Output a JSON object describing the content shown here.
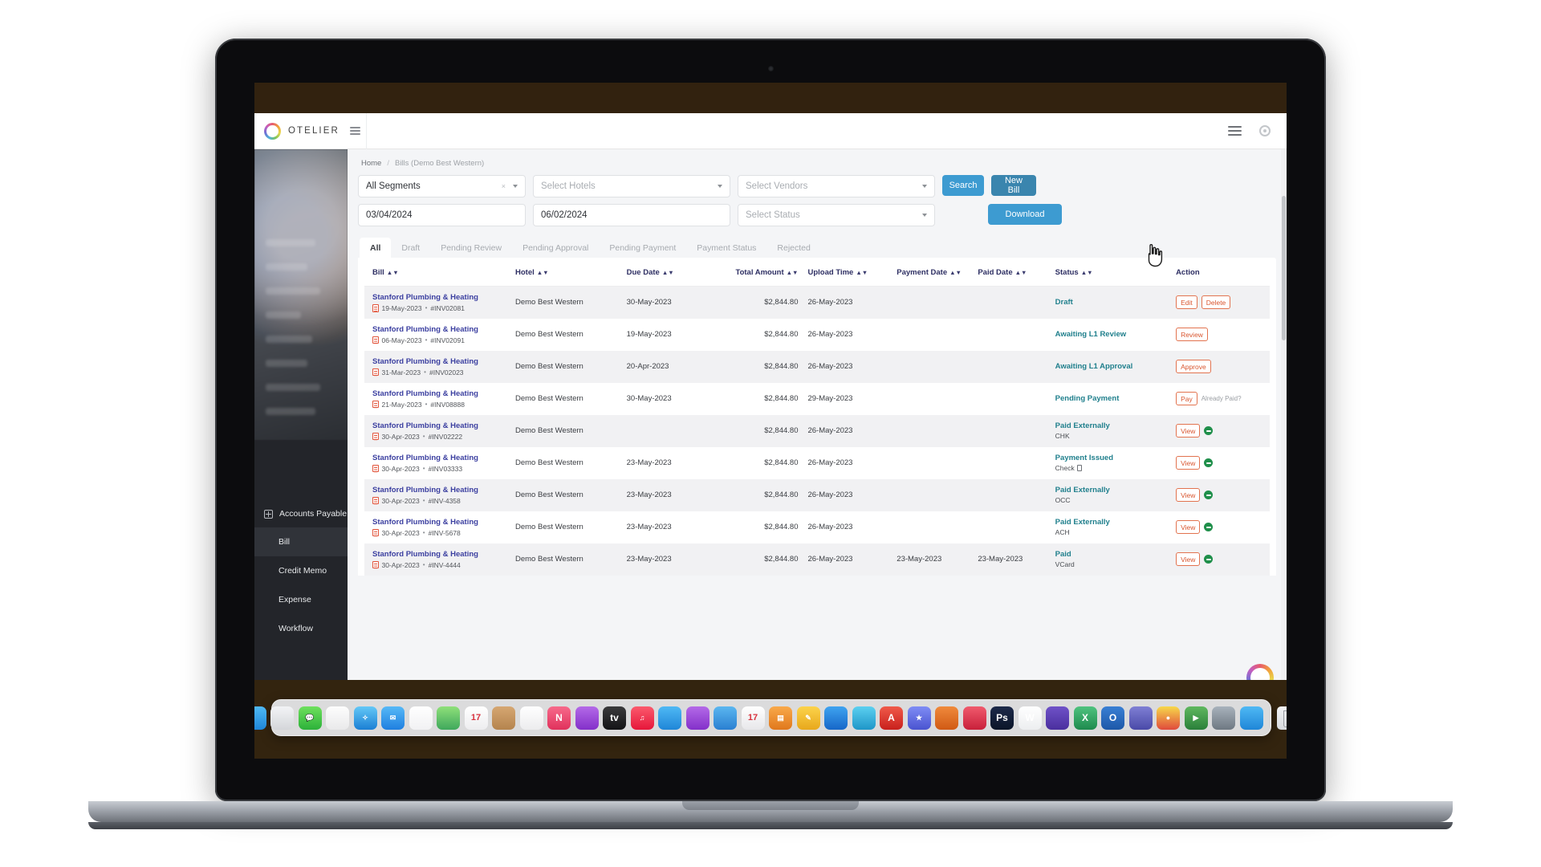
{
  "brand": {
    "name": "OTELIER",
    "menu_icon": "hamburger-icon",
    "ring_icon": "otelier-logo-ring"
  },
  "topbar": {
    "menu_icon": "hamburger-icon",
    "settings_icon": "gear-icon"
  },
  "sidebar": {
    "group_label": "Accounts Payable",
    "group_icon": "grid-icon",
    "items": [
      {
        "label": "Bill",
        "active": true
      },
      {
        "label": "Credit Memo",
        "active": false
      },
      {
        "label": "Expense",
        "active": false
      },
      {
        "label": "Workflow",
        "active": false
      }
    ]
  },
  "breadcrumb": {
    "home": "Home",
    "separator": "/",
    "current": "Bills (Demo Best Western)"
  },
  "filters": {
    "segment": {
      "value": "All Segments",
      "clear_icon": "clear-x-icon",
      "caret_icon": "chevron-down-icon"
    },
    "hotels": {
      "placeholder": "Select Hotels",
      "caret_icon": "chevron-down-icon"
    },
    "vendors": {
      "placeholder": "Select Vendors",
      "caret_icon": "chevron-down-icon"
    },
    "date_from": {
      "value": "03/04/2024"
    },
    "date_to": {
      "value": "06/02/2024"
    },
    "status": {
      "placeholder": "Select Status",
      "caret_icon": "chevron-down-icon"
    }
  },
  "buttons": {
    "search": "Search",
    "new_bill": "New Bill",
    "download": "Download"
  },
  "cursor": {
    "icon": "pointing-hand-cursor"
  },
  "tabs": [
    {
      "label": "All",
      "active": true
    },
    {
      "label": "Draft",
      "active": false
    },
    {
      "label": "Pending Review",
      "active": false
    },
    {
      "label": "Pending Approval",
      "active": false
    },
    {
      "label": "Pending Payment",
      "active": false
    },
    {
      "label": "Payment Status",
      "active": false
    },
    {
      "label": "Rejected",
      "active": false
    }
  ],
  "table": {
    "columns": [
      {
        "key": "bill",
        "label": "Bill",
        "sortable": true
      },
      {
        "key": "hotel",
        "label": "Hotel",
        "sortable": true
      },
      {
        "key": "due_date",
        "label": "Due Date",
        "sortable": true
      },
      {
        "key": "total_amount",
        "label": "Total Amount",
        "sortable": true
      },
      {
        "key": "upload_time",
        "label": "Upload Time",
        "sortable": true
      },
      {
        "key": "payment_date",
        "label": "Payment Date",
        "sortable": true
      },
      {
        "key": "paid_date",
        "label": "Paid Date",
        "sortable": true
      },
      {
        "key": "status",
        "label": "Status",
        "sortable": true
      },
      {
        "key": "action",
        "label": "Action",
        "sortable": false
      }
    ],
    "sort_icon": "sort-arrows-icon",
    "rows": [
      {
        "vendor": "Stanford Plumbing & Heating",
        "bill_date": "19-May-2023",
        "invoice_no": "#INV02081",
        "hotel": "Demo Best Western",
        "due_date": "30-May-2023",
        "total_amount": "$2,844.80",
        "upload_time": "26-May-2023",
        "payment_date": "",
        "paid_date": "",
        "status": "Draft",
        "status_sub": "",
        "actions": [
          "Edit",
          "Delete"
        ],
        "has_green_dot": false,
        "already_paid_text": ""
      },
      {
        "vendor": "Stanford Plumbing & Heating",
        "bill_date": "06-May-2023",
        "invoice_no": "#INV02091",
        "hotel": "Demo Best Western",
        "due_date": "19-May-2023",
        "total_amount": "$2,844.80",
        "upload_time": "26-May-2023",
        "payment_date": "",
        "paid_date": "",
        "status": "Awaiting L1 Review",
        "status_sub": "",
        "actions": [
          "Review"
        ],
        "has_green_dot": false,
        "already_paid_text": ""
      },
      {
        "vendor": "Stanford Plumbing & Heating",
        "bill_date": "31-Mar-2023",
        "invoice_no": "#INV02023",
        "hotel": "Demo Best Western",
        "due_date": "20-Apr-2023",
        "total_amount": "$2,844.80",
        "upload_time": "26-May-2023",
        "payment_date": "",
        "paid_date": "",
        "status": "Awaiting L1 Approval",
        "status_sub": "",
        "actions": [
          "Approve"
        ],
        "has_green_dot": false,
        "already_paid_text": ""
      },
      {
        "vendor": "Stanford Plumbing & Heating",
        "bill_date": "21-May-2023",
        "invoice_no": "#INV08888",
        "hotel": "Demo Best Western",
        "due_date": "30-May-2023",
        "total_amount": "$2,844.80",
        "upload_time": "29-May-2023",
        "payment_date": "",
        "paid_date": "",
        "status": "Pending Payment",
        "status_sub": "",
        "actions": [
          "Pay"
        ],
        "has_green_dot": false,
        "already_paid_text": "Already Paid?"
      },
      {
        "vendor": "Stanford Plumbing & Heating",
        "bill_date": "30-Apr-2023",
        "invoice_no": "#INV02222",
        "hotel": "Demo Best Western",
        "due_date": "",
        "total_amount": "$2,844.80",
        "upload_time": "26-May-2023",
        "payment_date": "",
        "paid_date": "",
        "status": "Paid Externally",
        "status_sub": "CHK",
        "actions": [
          "View"
        ],
        "has_green_dot": true,
        "already_paid_text": ""
      },
      {
        "vendor": "Stanford Plumbing & Heating",
        "bill_date": "30-Apr-2023",
        "invoice_no": "#INV03333",
        "hotel": "Demo Best Western",
        "due_date": "23-May-2023",
        "total_amount": "$2,844.80",
        "upload_time": "26-May-2023",
        "payment_date": "",
        "paid_date": "",
        "status": "Payment Issued",
        "status_sub": "Check",
        "status_sub_icon": "document-icon",
        "actions": [
          "View"
        ],
        "has_green_dot": true,
        "already_paid_text": ""
      },
      {
        "vendor": "Stanford Plumbing & Heating",
        "bill_date": "30-Apr-2023",
        "invoice_no": "#INV-4358",
        "hotel": "Demo Best Western",
        "due_date": "23-May-2023",
        "total_amount": "$2,844.80",
        "upload_time": "26-May-2023",
        "payment_date": "",
        "paid_date": "",
        "status": "Paid Externally",
        "status_sub": "OCC",
        "actions": [
          "View"
        ],
        "has_green_dot": true,
        "already_paid_text": ""
      },
      {
        "vendor": "Stanford Plumbing & Heating",
        "bill_date": "30-Apr-2023",
        "invoice_no": "#INV-5678",
        "hotel": "Demo Best Western",
        "due_date": "23-May-2023",
        "total_amount": "$2,844.80",
        "upload_time": "26-May-2023",
        "payment_date": "",
        "paid_date": "",
        "status": "Paid Externally",
        "status_sub": "ACH",
        "actions": [
          "View"
        ],
        "has_green_dot": true,
        "already_paid_text": ""
      },
      {
        "vendor": "Stanford Plumbing & Heating",
        "bill_date": "30-Apr-2023",
        "invoice_no": "#INV-4444",
        "hotel": "Demo Best Western",
        "due_date": "23-May-2023",
        "total_amount": "$2,844.80",
        "upload_time": "26-May-2023",
        "payment_date": "23-May-2023",
        "paid_date": "23-May-2023",
        "status": "Paid",
        "status_sub": "VCard",
        "actions": [
          "View"
        ],
        "has_green_dot": true,
        "already_paid_text": ""
      }
    ]
  },
  "colors": {
    "primary_blue": "#3d9bd1",
    "new_bill_blue": "#3a85ae",
    "vendor_purple": "#3b3fa0",
    "header_navy": "#2e2f63",
    "status_teal": "#1f7f8c",
    "action_orange": "#d9562f",
    "green": "#1f8f4a",
    "sidebar_dark": "#23252a"
  },
  "dock": {
    "icons": [
      "finder-icon",
      "launchpad-icon",
      "messages-icon",
      "notes-icon",
      "safari-icon",
      "mail-icon",
      "photos-icon",
      "maps-icon",
      "calendar-icon",
      "contacts-icon",
      "reminders-icon",
      "news-icon",
      "podcasts-icon",
      "appletv-icon",
      "music-icon",
      "numbers-icon",
      "podcast-alt-icon",
      "nordvpn-icon",
      "calendar2-icon",
      "charts-icon",
      "pencil-icon",
      "app-store-icon",
      "chrome-alt-icon",
      "acrobat-icon",
      "star-icon",
      "keynote-icon",
      "preview-icon",
      "photoshop-icon",
      "word-icon",
      "onenote-icon",
      "excel-icon",
      "outlook-icon",
      "teams-icon",
      "chrome-icon",
      "terminal-icon",
      "filezilla-icon",
      "finder-alt-icon",
      "trash-icon"
    ]
  }
}
